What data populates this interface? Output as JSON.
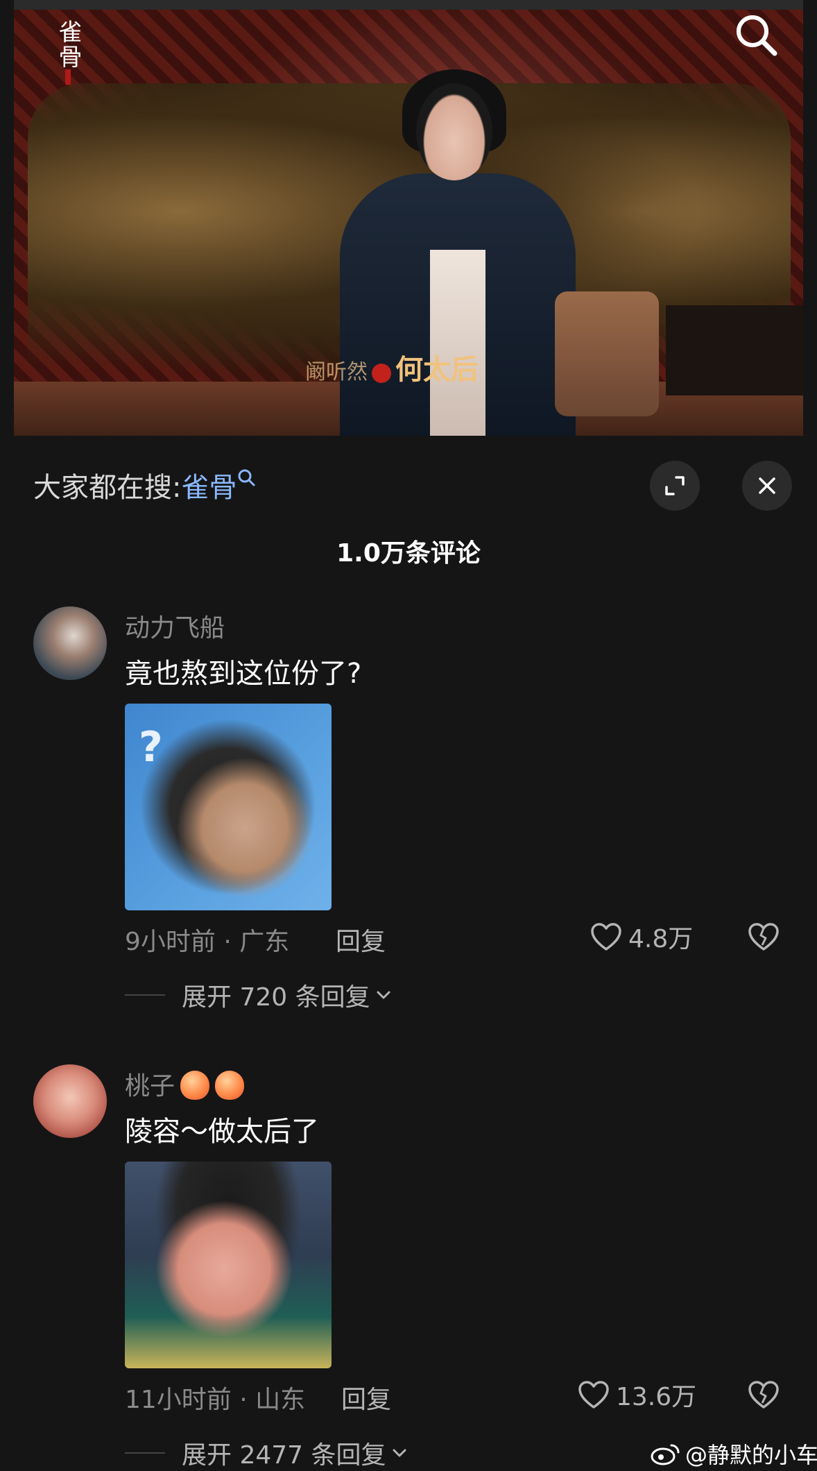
{
  "video": {
    "logo_text": "雀骨",
    "caption_actor": "阚听然",
    "caption_role": "何太后"
  },
  "panel": {
    "hot_search_label": "大家都在搜:",
    "hot_search_term": "雀骨",
    "comment_count": "1.0万条评论"
  },
  "comments": [
    {
      "username": "动力飞船",
      "text": "竟也熬到这位份了?",
      "time_location": "9小时前 · 广东",
      "reply_label": "回复",
      "likes": "4.8万",
      "expand_label": "展开 720 条回复"
    },
    {
      "username": "桃子",
      "text": "陵容～做太后了",
      "time_location": "11小时前 · 山东",
      "reply_label": "回复",
      "likes": "13.6万",
      "expand_label": "展开 2477 条回复"
    }
  ],
  "watermark": "@静默的小车",
  "icons": {
    "search": "search-icon",
    "expand": "expand-icon",
    "close": "close-icon",
    "heart": "heart-icon",
    "broken_heart": "broken-heart-icon",
    "chevron": "chevron-down-icon",
    "weibo": "weibo-icon"
  },
  "colors": {
    "background": "#151515",
    "link_blue": "#8ab8ff",
    "muted_text": "#8a8a8a"
  }
}
